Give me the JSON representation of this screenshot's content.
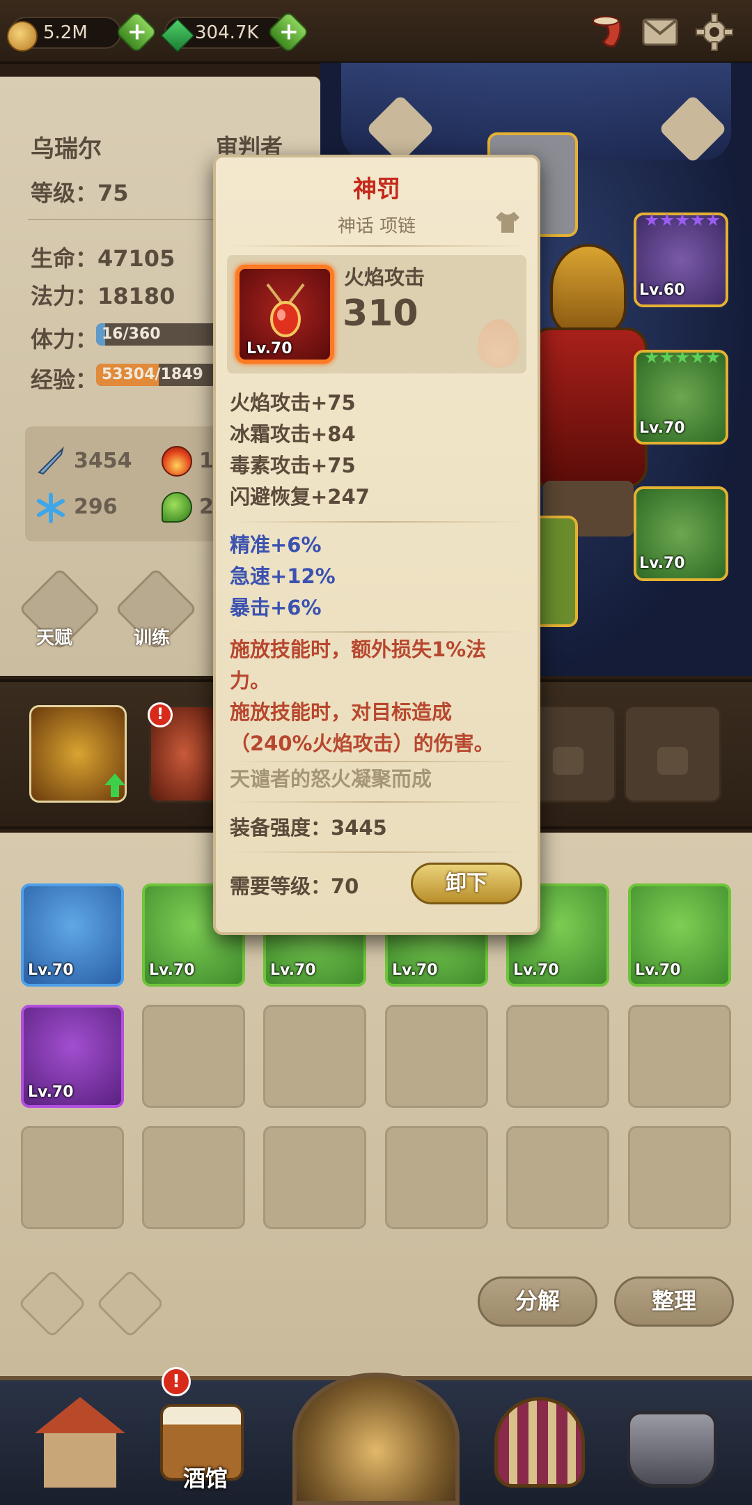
{
  "resources": {
    "gold": "5.2M",
    "gems": "304.7K"
  },
  "hero": {
    "name": "乌瑞尔",
    "class": "审判者",
    "level_label": "等级：75",
    "hp_label": "生命：47105",
    "mp_label": "法力：18180",
    "stamina_label": "体力：",
    "stamina_value": "16/360",
    "stamina_fraction": 0.044,
    "exp_label": "经验：",
    "exp_value": "53304/1849",
    "exp_fraction": 0.3,
    "stats": {
      "attack": "3454",
      "fire": "1",
      "ice": "296",
      "poison": "2"
    },
    "talent_label": "天赋",
    "train_label": "训练"
  },
  "equipped_slots": [
    {
      "level": "Lv.60",
      "stars": 5,
      "star_color": "#9b5cf0",
      "border": "#e4b133"
    },
    {
      "level": "Lv.70",
      "stars": 5,
      "star_color": "#5ed15a",
      "border": "#e4b133"
    },
    {
      "level": "Lv.70",
      "stars": 0,
      "star_color": "#5ed15a",
      "border": "#e4b133"
    }
  ],
  "inventory": {
    "row1": [
      "Lv.70",
      "Lv.70",
      "Lv.70",
      "Lv.70",
      "Lv.70",
      "Lv.70"
    ],
    "row2": [
      "Lv.70"
    ],
    "decompose_label": "分解",
    "sort_label": "整理"
  },
  "nav": {
    "tavern_label": "酒馆",
    "alert_mark": "!"
  },
  "tooltip": {
    "name": "神罚",
    "rarity_type": "神话 项链",
    "main_stat_label": "火焰攻击",
    "main_stat_value": "310",
    "item_level": "Lv.70",
    "base_stats": [
      "火焰攻击+75",
      "冰霜攻击+84",
      "毒素攻击+75",
      "闪避恢复+247"
    ],
    "bonus_stats": [
      "精准+6%",
      "急速+12%",
      "暴击+6%"
    ],
    "special_effects": [
      "施放技能时，额外损失1%法力。",
      "施放技能时，对目标造成（240%火焰攻击）的伤害。"
    ],
    "flavor": "天谴者的怒火凝聚而成",
    "power_label": "装备强度：3445",
    "required_level": "需要等级：70",
    "unequip_label": "卸下"
  },
  "colors": {
    "mythic_red": "#c4291b",
    "bonus_blue": "#3b52b0",
    "effect_red": "#b7472e",
    "unequip_gold": "#ead27a"
  }
}
